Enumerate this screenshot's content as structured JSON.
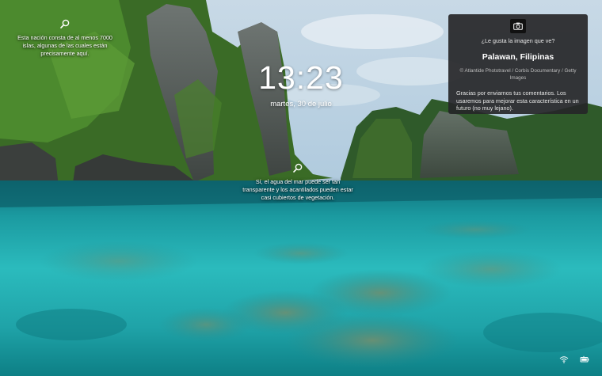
{
  "lockscreen": {
    "time": "13:23",
    "date": "martes, 30 de julio"
  },
  "hotspots": [
    {
      "icon": "magnifier-icon",
      "text": "Esta nación consta de al menos 7000 islas, algunas de las cuales están precisamente aquí."
    },
    {
      "icon": "magnifier-icon",
      "text": "Sí, el agua del mar puede ser tan transparente y los acantilados pueden estar casi cubiertos de vegetación."
    }
  ],
  "info_panel": {
    "icon": "camera-icon",
    "question": "¿Le gusta la imagen que ve?",
    "location": "Palawan, Filipinas",
    "credit": "© Atlantide Phototravel / Corbis Documentary / Getty Images",
    "thanks": "Gracias por enviarnos tus comentarios. Los usaremos para mejorar esta característica en un futuro (no muy lejano)."
  },
  "tray": {
    "icons": [
      "wifi-icon",
      "battery-icon"
    ]
  },
  "colors": {
    "panel_bg": "#262628",
    "water_light": "#2fc1c4",
    "water_dark": "#0b6f7e",
    "sky": "#b9d2e2",
    "jungle": "#3f7a2a"
  }
}
